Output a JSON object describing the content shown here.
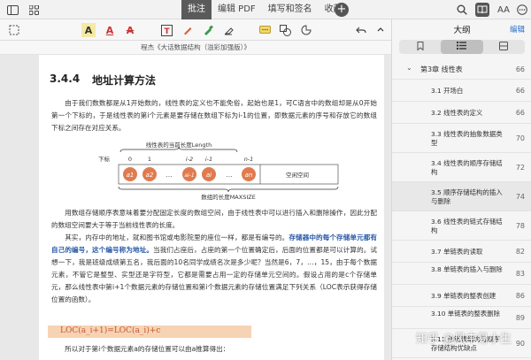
{
  "topbar": {
    "tabs": [
      {
        "label": "批注"
      },
      {
        "label": "编辑 PDF"
      },
      {
        "label": "填写和签名"
      },
      {
        "label": "收藏"
      }
    ],
    "plus": "+",
    "aa_label": "AA"
  },
  "toolbar": {
    "highlight_glyph": "A",
    "underline_glyph": "A",
    "strike_glyph": "A"
  },
  "document": {
    "title": "程杰《大话数据结构（溢彩加强版）》",
    "section_number": "3.4.4",
    "section_title": "地址计算方法",
    "para1": "由于我们数数都是从1开始数的，线性表的定义也不能免俗，起始也是1，可C语言中的数组却是从0开始第一个下标的，于是线性表的第i个元素是要存储在数组下标为i-1的位置，即数据元素的序号和存放它的数组下标之间存在对应关系。",
    "diagram": {
      "top_label": "线性表的当前长度Length",
      "index_label": "下标",
      "indices": [
        "0",
        "1",
        "i-2",
        "i-1",
        "",
        "n-1"
      ],
      "cells": [
        "a1",
        "a2",
        "…",
        "ai-1",
        "ai",
        "…",
        "an"
      ],
      "space_label": "空闲空间",
      "bottom_label": "数组的长度MAXSIZE"
    },
    "para2": "用数组存储顺序表意味着要分配固定长度的数组空间，由于线性表中可以进行插入和删除操作，因此分配的数组空间要大于等于当前线性表的长度。",
    "para3_pre": "其实，内存中的地址，就和图书馆或电影院里的座位一样，都是有编号的。",
    "para3_hl": "存储器中的每个存储单元都有自己的编号，这个编号称为地址。",
    "para3_post": "当我们占座后，占座的第一个位置确定后，后面的位置都是可以计算的。试想一下，我是班级成绩第五名，我后面的10名同学成绩名次是多少呢？当然是6，7，…，15，由于每个数据元素，不管它是整型、实型还是字符型，它都是需要占用一定的存储单元空间的。假设占用的是c个存储单元，那么线性表中第i+1个数据元素的存储位置和第i个数据元素的存储位置满足下列关系（LOC表示获得存储位置的函数）。",
    "formula": "LOC(a_i+1)=LOC(a_i)+c",
    "para4": "所以对于第i个数据元素a的存储位置可以由a推算得出："
  },
  "sidebar": {
    "title": "大纲",
    "edit_label": "编辑",
    "toc": [
      {
        "label": "第3章 线性表",
        "page": "66",
        "chapter": true
      },
      {
        "label": "3.1 开场白",
        "page": "66"
      },
      {
        "label": "3.2 线性表的定义",
        "page": "66"
      },
      {
        "label": "3.3 线性表的抽象数据类型",
        "page": "70"
      },
      {
        "label": "3.4 线性表的顺序存储结构",
        "page": "72"
      },
      {
        "label": "3.5 顺序存储结构的插入与删除",
        "page": "74",
        "active": true
      },
      {
        "label": "3.6 线性表的链式存储结构",
        "page": "78"
      },
      {
        "label": "3.7 单链表的读取",
        "page": "82"
      },
      {
        "label": "3.8 单链表的插入与删除",
        "page": "83"
      },
      {
        "label": "3.9 单链表的整表创建",
        "page": "86"
      },
      {
        "label": "3.10 单链表的整表删除",
        "page": "89"
      },
      {
        "label": "3.11 单链表结构与顺序存储结构优缺点",
        "page": "90"
      }
    ]
  },
  "watermark": "知乎 @风中易小生",
  "colors": {
    "accent": "#2a6ec7",
    "cell": "#e07b4f",
    "formula_bg": "#f7d3b5"
  }
}
